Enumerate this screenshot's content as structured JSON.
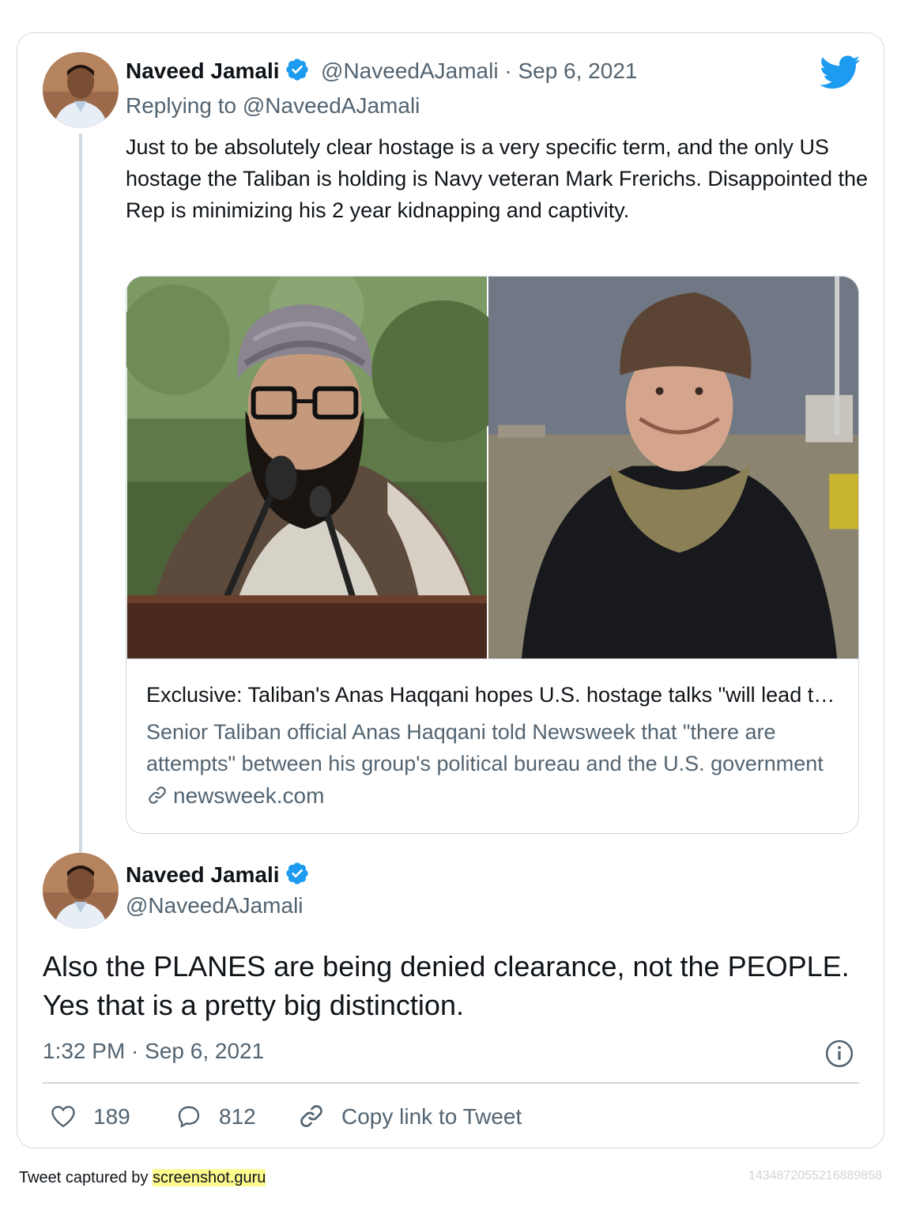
{
  "parent": {
    "author_name": "Naveed Jamali",
    "handle": "@NaveedAJamali",
    "separator": " · ",
    "date": "Sep 6, 2021",
    "replying_to": "Replying to @NaveedAJamali",
    "text": "Just to be absolutely clear hostage is a very specific term, and the only US hostage the Taliban is holding is Navy veteran Mark Frerichs. Disappointed the Rep is minimizing his 2 year kidnapping and captivity.",
    "link_card": {
      "title": "Exclusive: Taliban's Anas Haqqani hopes U.S. hostage talks \"will lead to a good result\"",
      "description": "Senior Taliban official Anas Haqqani told Newsweek that \"there are attempts\" between his group's political bureau and the U.S. government to reach a resolution.",
      "domain": "newsweek.com",
      "image_left_icon": "photo-man-turban-microphone",
      "image_right_icon": "photo-man-hat-smiling"
    }
  },
  "tweet": {
    "author_name": "Naveed Jamali",
    "handle": "@NaveedAJamali",
    "text": "Also the PLANES are being denied clearance, not the PEOPLE. Yes that is a pretty big distinction.",
    "timestamp": "1:32 PM · Sep 6, 2021",
    "likes": "189",
    "replies": "812",
    "copy_link_label": "Copy link to Tweet"
  },
  "footer": {
    "captured_by": "Tweet captured by ",
    "site": "screenshot.guru",
    "tweet_id": "1434872055216889858"
  },
  "colors": {
    "twitter_blue": "#1d9bf0",
    "secondary_text": "#536471",
    "border": "#cfd9de",
    "highlight": "#fdfa8e"
  },
  "icons": [
    "twitter-bird-icon",
    "verified-badge-icon",
    "link-icon",
    "heart-icon",
    "reply-bubble-icon",
    "copy-link-icon",
    "info-icon"
  ]
}
